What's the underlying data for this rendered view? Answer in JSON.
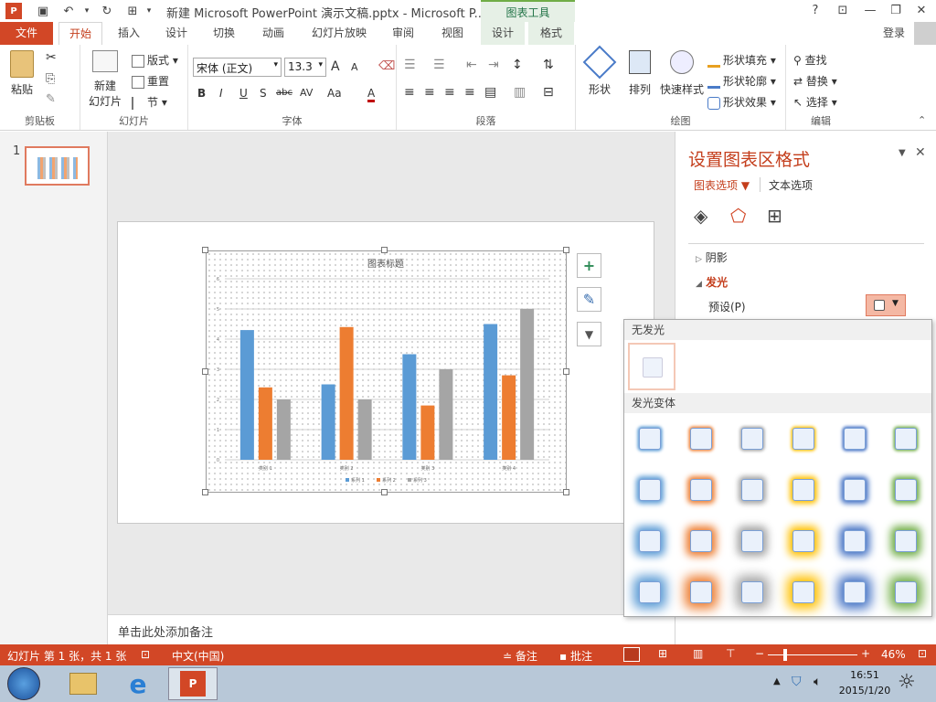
{
  "title_bar": {
    "title": "新建 Microsoft PowerPoint 演示文稿.pptx - Microsoft P...",
    "context_tab": "图表工具",
    "help": "?",
    "win_ribbon": "⊡",
    "win_min": "—",
    "win_restore": "❐",
    "win_close": "✕"
  },
  "tabs": [
    {
      "label": "文件"
    },
    {
      "label": "开始"
    },
    {
      "label": "插入"
    },
    {
      "label": "设计"
    },
    {
      "label": "切换"
    },
    {
      "label": "动画"
    },
    {
      "label": "幻灯片放映"
    },
    {
      "label": "审阅"
    },
    {
      "label": "视图"
    },
    {
      "label": "设计"
    },
    {
      "label": "格式"
    }
  ],
  "login": "登录",
  "ribbon": {
    "clipboard": {
      "paste": "粘贴",
      "label": "剪贴板"
    },
    "slides": {
      "new_slide_1": "新建",
      "new_slide_2": "幻灯片",
      "layout": "版式",
      "reset": "重置",
      "section": "节",
      "label": "幻灯片"
    },
    "font": {
      "font_name": "宋体 (正文)",
      "font_size": "13.3",
      "grow": "A",
      "shrink": "A",
      "bold": "B",
      "italic": "I",
      "underline": "U",
      "shadow": "S",
      "strike": "abc",
      "spacing": "AV",
      "case": "Aa",
      "color": "A",
      "label": "字体"
    },
    "paragraph": {
      "label": "段落"
    },
    "drawing": {
      "shape": "形状",
      "arrange": "排列",
      "quick_style": "快速样式",
      "fill": "形状填充",
      "outline": "形状轮廓",
      "effect": "形状效果",
      "label": "绘图"
    },
    "editing": {
      "find": "查找",
      "replace": "替换",
      "select": "选择",
      "label": "编辑"
    }
  },
  "thumbnail": {
    "number": "1"
  },
  "chart_data": {
    "type": "bar",
    "title": "图表标题",
    "categories": [
      "类别 1",
      "类别 2",
      "类别 3",
      "类别 4"
    ],
    "series": [
      {
        "name": "系列 1",
        "values": [
          4.3,
          2.5,
          3.5,
          4.5
        ],
        "color": "#5b9bd5"
      },
      {
        "name": "系列 2",
        "values": [
          2.4,
          4.4,
          1.8,
          2.8
        ],
        "color": "#ed7d31"
      },
      {
        "name": "系列 3",
        "values": [
          2,
          2,
          3,
          5
        ],
        "color": "#a5a5a5"
      }
    ],
    "ylim": [
      0,
      6
    ],
    "yticks": [
      "0",
      "1",
      "2",
      "3",
      "4",
      "5",
      "6"
    ],
    "grid": true,
    "legend": "bottom"
  },
  "chart_side_icons": {
    "add": "+",
    "style": "✎",
    "filter": "▼"
  },
  "notes": {
    "placeholder": "单击此处添加备注"
  },
  "format_pane": {
    "title": "设置图表区格式",
    "tab_chart": "图表选项",
    "tab_text": "文本选项",
    "shadow": "阴影",
    "glow": "发光",
    "preset": "预设(P)"
  },
  "glow_gallery": {
    "no_glow": "无发光",
    "variants": "发光变体",
    "colors": [
      "#5b9bd5",
      "#ed7d31",
      "#a5a5a5",
      "#ffc000",
      "#4472c4",
      "#70ad47"
    ]
  },
  "status": {
    "slide_info": "幻灯片 第 1 张，共 1 张",
    "language": "中文(中国)",
    "notes": "备注",
    "comments": "批注",
    "zoom": "46%"
  },
  "taskbar": {
    "time": "16:51",
    "date": "2015/1/20"
  }
}
